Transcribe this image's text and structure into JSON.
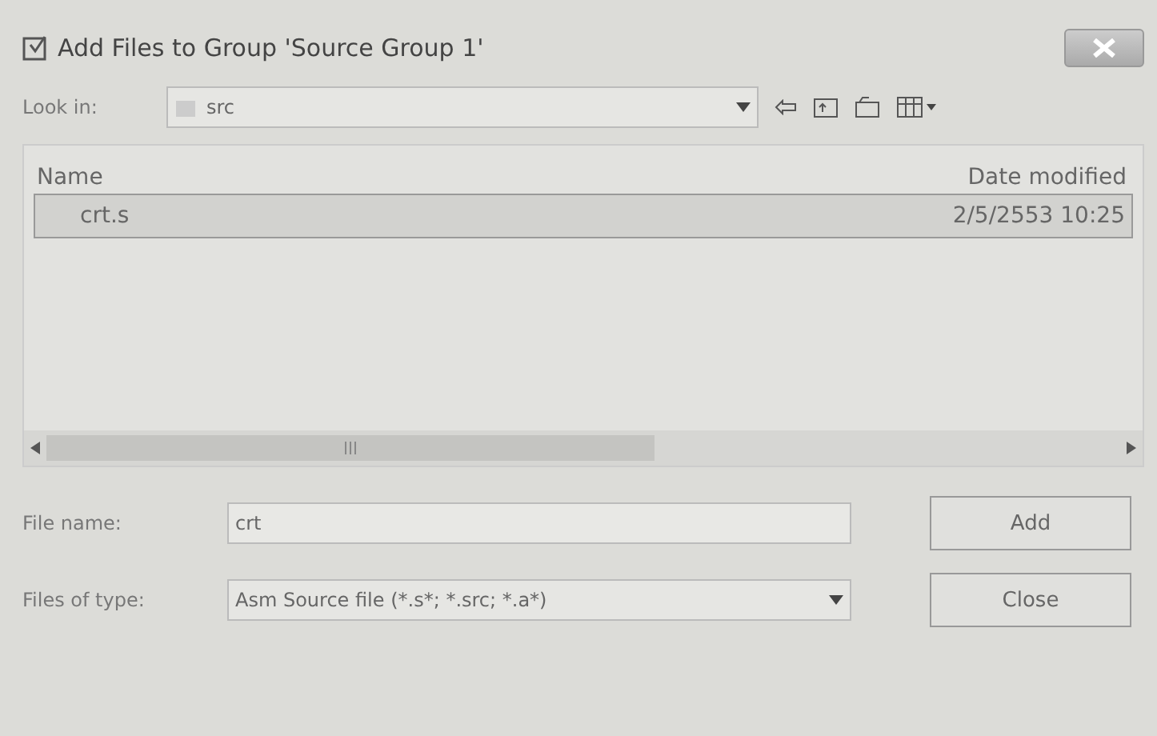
{
  "window": {
    "title": "Add Files to Group 'Source Group 1'"
  },
  "look_in": {
    "label": "Look in:",
    "value": "src"
  },
  "file_list": {
    "columns": [
      "Name",
      "Date modified"
    ],
    "rows": [
      {
        "name": "crt.s",
        "date_modified": "2/5/2553 10:25",
        "selected": true
      }
    ]
  },
  "file_name": {
    "label": "File name:",
    "value": "crt"
  },
  "files_of_type": {
    "label": "Files of type:",
    "value": "Asm Source file (*.s*; *.src; *.a*)"
  },
  "buttons": [
    {
      "label": "Add"
    },
    {
      "label": "Close"
    }
  ]
}
